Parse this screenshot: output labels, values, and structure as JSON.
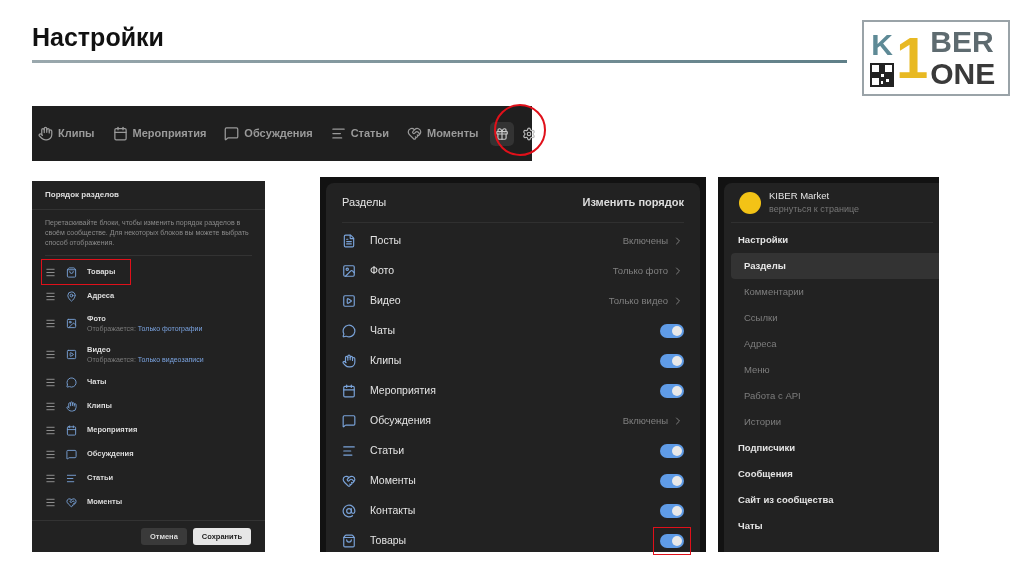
{
  "slide": {
    "title": "Настройки"
  },
  "logo": {
    "letter": "K",
    "digit": "1",
    "top_word": "BER",
    "bottom_word": "ONE"
  },
  "toolbar": {
    "items": [
      {
        "label": "Клипы"
      },
      {
        "label": "Мероприятия"
      },
      {
        "label": "Обсуждения"
      },
      {
        "label": "Статьи"
      },
      {
        "label": "Моменты"
      }
    ]
  },
  "order_dialog": {
    "title": "Порядок разделов",
    "description": "Перетаскивайте блоки, чтобы изменить порядок разделов в своём сообществе. Для некоторых блоков вы можете выбрать способ отображения.",
    "items": [
      {
        "label": "Товары",
        "highlighted": true
      },
      {
        "label": "Адреса",
        "highlighted": false
      },
      {
        "label": "Фото",
        "hint": "Отображается:",
        "link": "Только фотографии",
        "highlighted": false
      },
      {
        "label": "Видео",
        "hint": "Отображается:",
        "link": "Только видеозаписи",
        "highlighted": false
      },
      {
        "label": "Чаты",
        "highlighted": false
      },
      {
        "label": "Клипы",
        "highlighted": false
      },
      {
        "label": "Мероприятия",
        "highlighted": false
      },
      {
        "label": "Обсуждения",
        "highlighted": false
      },
      {
        "label": "Статьи",
        "highlighted": false
      },
      {
        "label": "Моменты",
        "highlighted": false
      }
    ],
    "buttons": [
      {
        "label": "Отмена",
        "primary": false
      },
      {
        "label": "Сохранить",
        "primary": true
      }
    ]
  },
  "sections": {
    "title": "Разделы",
    "action": "Изменить порядок",
    "rows": [
      {
        "label": "Посты",
        "kind": "value",
        "value": "Включены",
        "highlighted": false
      },
      {
        "label": "Фото",
        "kind": "value",
        "value": "Только фото",
        "highlighted": false
      },
      {
        "label": "Видео",
        "kind": "value",
        "value": "Только видео",
        "highlighted": false
      },
      {
        "label": "Чаты",
        "kind": "toggle",
        "on": true,
        "highlighted": false
      },
      {
        "label": "Клипы",
        "kind": "toggle",
        "on": true,
        "highlighted": false
      },
      {
        "label": "Мероприятия",
        "kind": "toggle",
        "on": true,
        "highlighted": false
      },
      {
        "label": "Обсуждения",
        "kind": "value",
        "value": "Включены",
        "highlighted": false
      },
      {
        "label": "Статьи",
        "kind": "toggle",
        "on": true,
        "highlighted": false
      },
      {
        "label": "Моменты",
        "kind": "toggle",
        "on": true,
        "highlighted": false
      },
      {
        "label": "Контакты",
        "kind": "toggle",
        "on": true,
        "highlighted": false
      },
      {
        "label": "Товары",
        "kind": "toggle",
        "on": true,
        "highlighted": true
      }
    ]
  },
  "sidebar": {
    "community": {
      "name": "KIBER Market",
      "link": "вернуться к странице"
    },
    "items": [
      {
        "label": "Настройки",
        "kind": "heading",
        "selected": false
      },
      {
        "label": "Разделы",
        "kind": "sub",
        "selected": true
      },
      {
        "label": "Комментарии",
        "kind": "sub",
        "selected": false
      },
      {
        "label": "Ссылки",
        "kind": "sub",
        "selected": false
      },
      {
        "label": "Адреса",
        "kind": "sub",
        "selected": false
      },
      {
        "label": "Меню",
        "kind": "sub",
        "selected": false
      },
      {
        "label": "Работа с API",
        "kind": "sub",
        "selected": false
      },
      {
        "label": "Истории",
        "kind": "sub",
        "selected": false
      },
      {
        "label": "Подписчики",
        "kind": "heading",
        "selected": false
      },
      {
        "label": "Сообщения",
        "kind": "heading",
        "selected": false
      },
      {
        "label": "Сайт из сообщества",
        "kind": "heading",
        "selected": false
      },
      {
        "label": "Чаты",
        "kind": "heading",
        "selected": false
      }
    ]
  }
}
